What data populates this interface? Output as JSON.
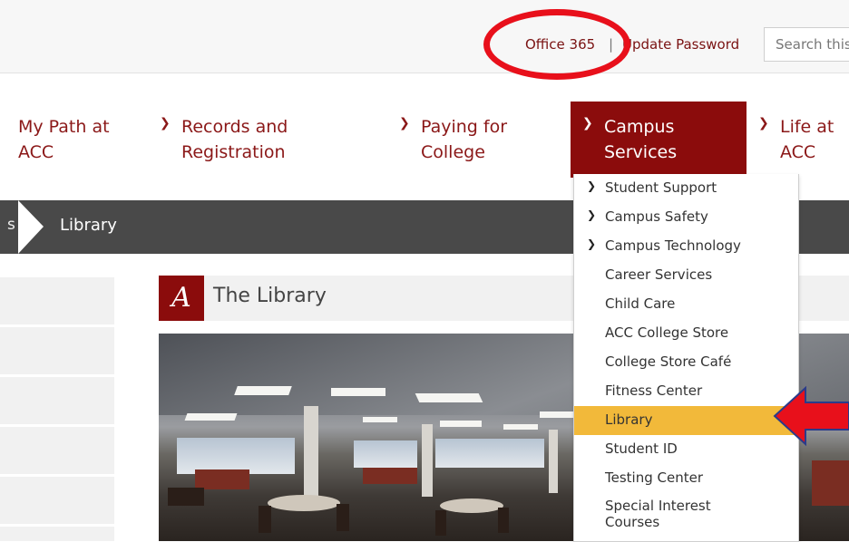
{
  "topbar": {
    "office_label": "Office 365",
    "separator": "|",
    "password_label": "Update Password",
    "search_placeholder": "Search this site"
  },
  "nav": {
    "items": [
      {
        "label_line1": "My Path at",
        "label_line2": "ACC",
        "has_chevron": false
      },
      {
        "label_line1": "Records and",
        "label_line2": "Registration",
        "has_chevron": true
      },
      {
        "label_line1": "Paying for",
        "label_line2": "College",
        "has_chevron": true
      },
      {
        "label_line1": "Campus",
        "label_line2": "Services",
        "has_chevron": true,
        "active": true
      },
      {
        "label_line1": "Life at",
        "label_line2": "ACC",
        "has_chevron": true
      }
    ]
  },
  "breadcrumb": {
    "previous": "s",
    "current": "Library"
  },
  "page": {
    "title": "The Library",
    "logo_letter": "A"
  },
  "dropdown": {
    "items": [
      {
        "label": "Student Support",
        "has_chevron": true
      },
      {
        "label": "Campus Safety",
        "has_chevron": true
      },
      {
        "label": "Campus Technology",
        "has_chevron": true
      },
      {
        "label": "Career Services"
      },
      {
        "label": "Child Care"
      },
      {
        "label": "ACC College Store"
      },
      {
        "label": "College Store Café"
      },
      {
        "label": "Fitness Center"
      },
      {
        "label": "Library",
        "highlighted": true
      },
      {
        "label": "Student ID"
      },
      {
        "label": "Testing Center"
      },
      {
        "label": "Special Interest",
        "label_line2": "Courses"
      }
    ]
  },
  "colors": {
    "brand_maroon": "#8b0c0c",
    "highlight_gold": "#f2b93a",
    "breadcrumb_bg": "#494949",
    "annotation_red": "#e8101b"
  },
  "icons": {
    "chevron": "chevron-right-icon",
    "logo": "acc-logo-icon"
  }
}
